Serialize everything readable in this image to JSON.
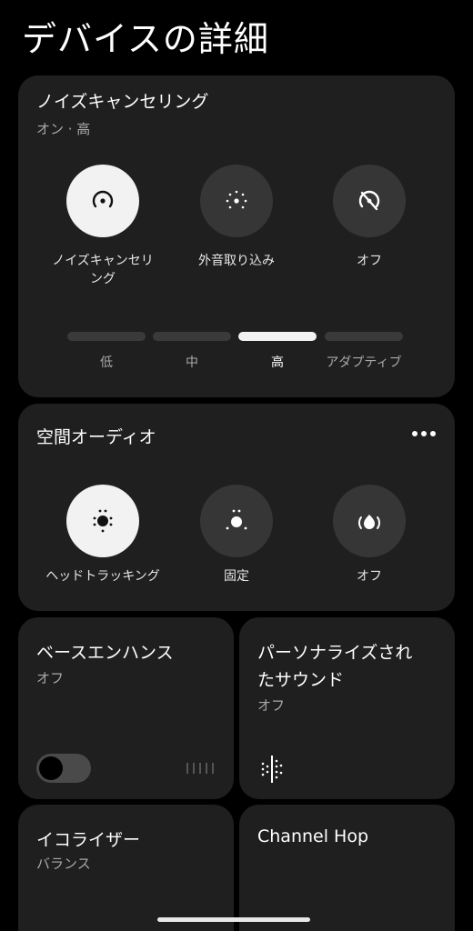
{
  "header": {
    "title": "デバイスの詳細"
  },
  "noise_cancelling": {
    "title": "ノイズキャンセリング",
    "status": "オン · 高",
    "modes": [
      {
        "label": "ノイズキャンセリ\nング",
        "icon": "noise-cancel-icon",
        "active": true
      },
      {
        "label": "外音取り込み",
        "icon": "ambient-sound-icon",
        "active": false
      },
      {
        "label": "オフ",
        "icon": "anc-off-icon",
        "active": false
      }
    ],
    "levels": [
      {
        "label": "低",
        "active": false
      },
      {
        "label": "中",
        "active": false
      },
      {
        "label": "高",
        "active": true
      },
      {
        "label": "アダプティブ",
        "active": false
      }
    ]
  },
  "spatial_audio": {
    "title": "空間オーディオ",
    "more_icon": "more-horizontal-icon",
    "modes": [
      {
        "label": "ヘッドトラッキング",
        "icon": "head-tracking-icon",
        "active": true
      },
      {
        "label": "固定",
        "icon": "fixed-spatial-icon",
        "active": false
      },
      {
        "label": "オフ",
        "icon": "spatial-off-icon",
        "active": false
      }
    ]
  },
  "bass_enhance": {
    "title": "ベースエンハンス",
    "status": "オフ",
    "enabled": false
  },
  "personalized_sound": {
    "title": "パーソナライズされ\nたサウンド",
    "status": "オフ"
  },
  "equalizer": {
    "title": "イコライザー",
    "status": "バランス"
  },
  "channel_hop": {
    "title": "Channel Hop"
  },
  "colors": {
    "card": "#1f1f1f",
    "active": "#f2f2f2",
    "inactive": "#363636",
    "muted": "#a8a8a8"
  }
}
